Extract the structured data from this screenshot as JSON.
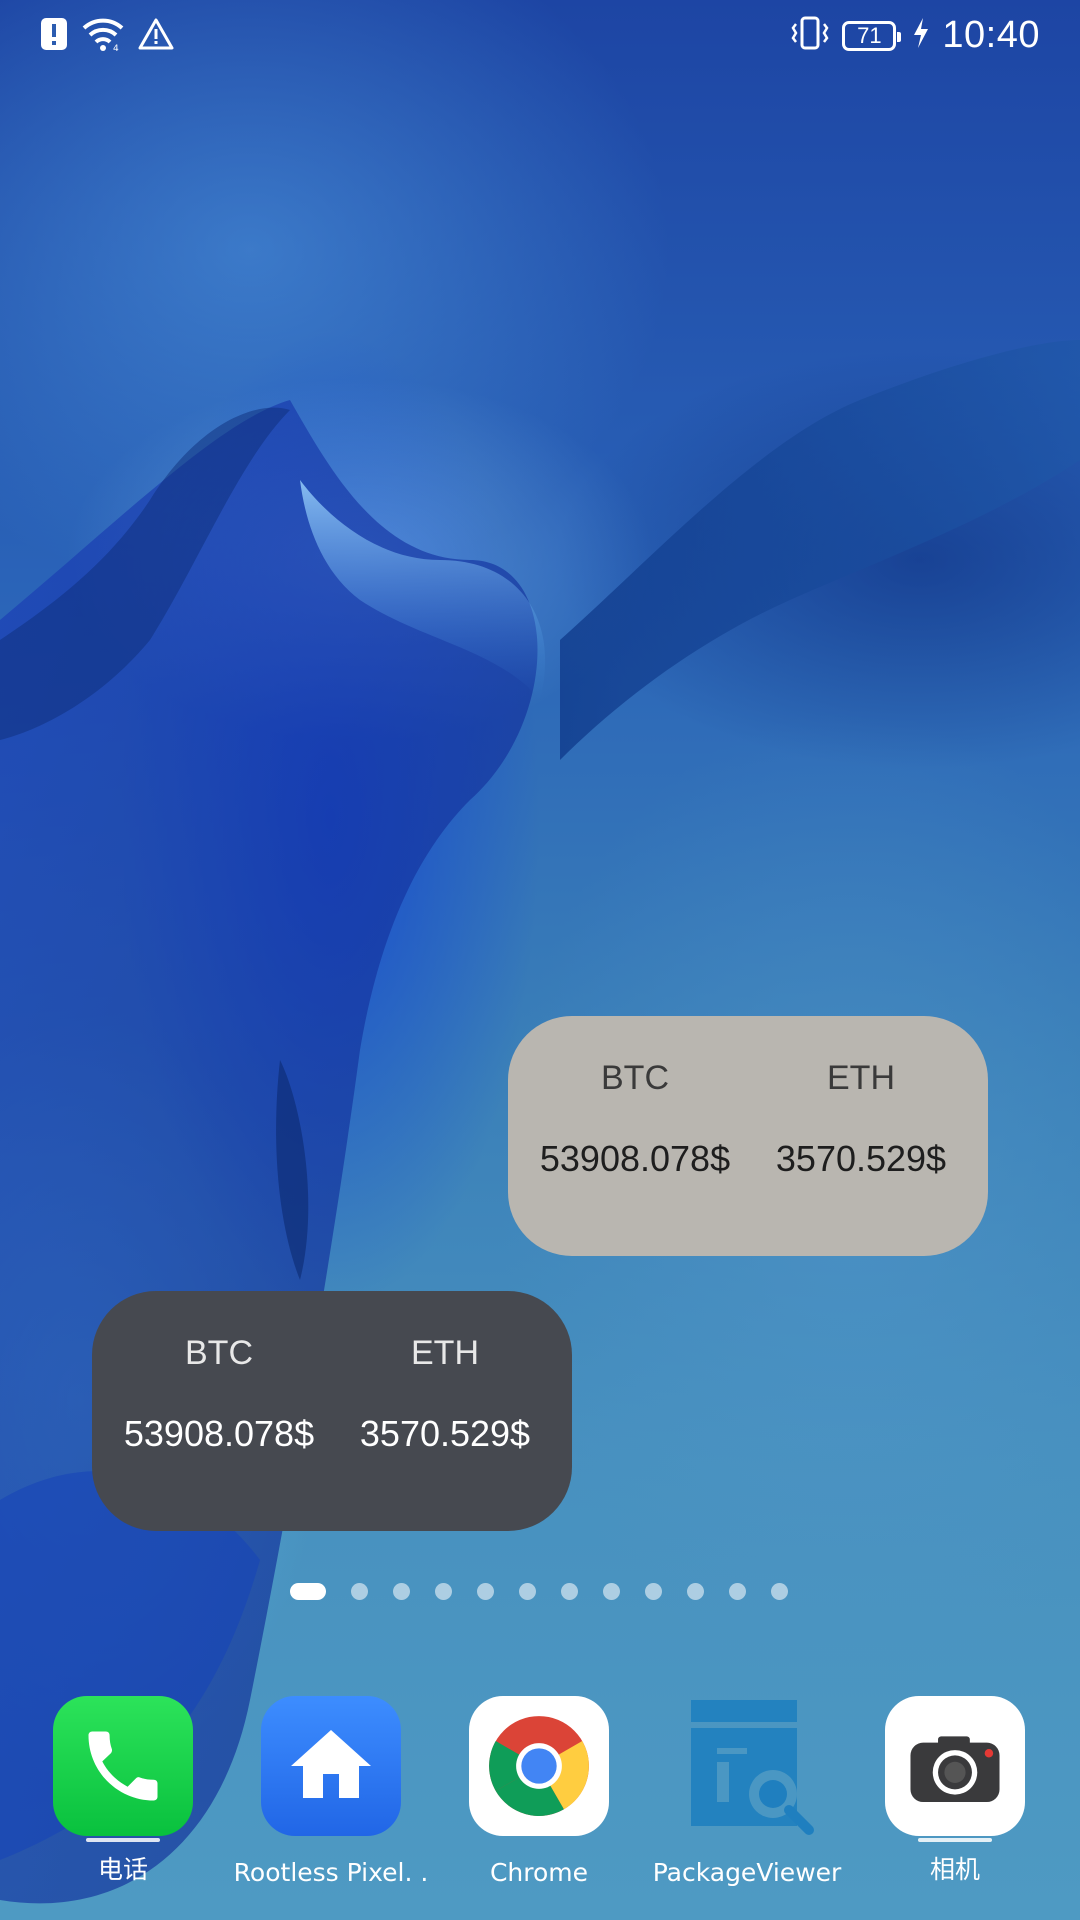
{
  "status_bar": {
    "time": "10:40",
    "battery_level": "71",
    "left_icons": [
      "alert-icon",
      "wifi-icon",
      "warning-icon"
    ],
    "right_icons": [
      "vibrate-icon",
      "battery-icon",
      "charging-icon"
    ]
  },
  "widgets": [
    {
      "theme": "light",
      "background": "#b9b6b0",
      "coins": [
        {
          "symbol": "BTC",
          "price": "53908.078$"
        },
        {
          "symbol": "ETH",
          "price": "3570.529$"
        }
      ]
    },
    {
      "theme": "dark",
      "background": "#464950",
      "coins": [
        {
          "symbol": "BTC",
          "price": "53908.078$"
        },
        {
          "symbol": "ETH",
          "price": "3570.529$"
        }
      ]
    }
  ],
  "page_indicator": {
    "total": 12,
    "active": 1
  },
  "dock": [
    {
      "label": "电话",
      "icon": "phone-icon"
    },
    {
      "label": "Rootless Pixel. .",
      "icon": "home-icon"
    },
    {
      "label": "Chrome",
      "icon": "chrome-icon"
    },
    {
      "label": "PackageViewer",
      "icon": "package-viewer-icon"
    },
    {
      "label": "相机",
      "icon": "camera-icon"
    }
  ]
}
